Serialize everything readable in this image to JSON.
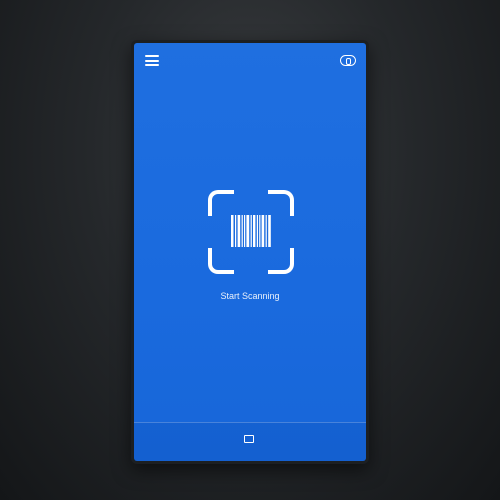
{
  "topbar": {
    "menu_icon": "hamburger-menu-icon",
    "account_label": "",
    "account_icon": "account-icon"
  },
  "scanner": {
    "frame_icon": "scan-frame-icon",
    "barcode_icon": "barcode-icon",
    "start_label": "Start Scanning"
  },
  "bottom": {
    "button_icon": "card-icon",
    "button_label": ""
  },
  "colors": {
    "screen_blue": "#1f6fe0",
    "text_white": "#ffffff",
    "bezel": "#1c1f22"
  }
}
